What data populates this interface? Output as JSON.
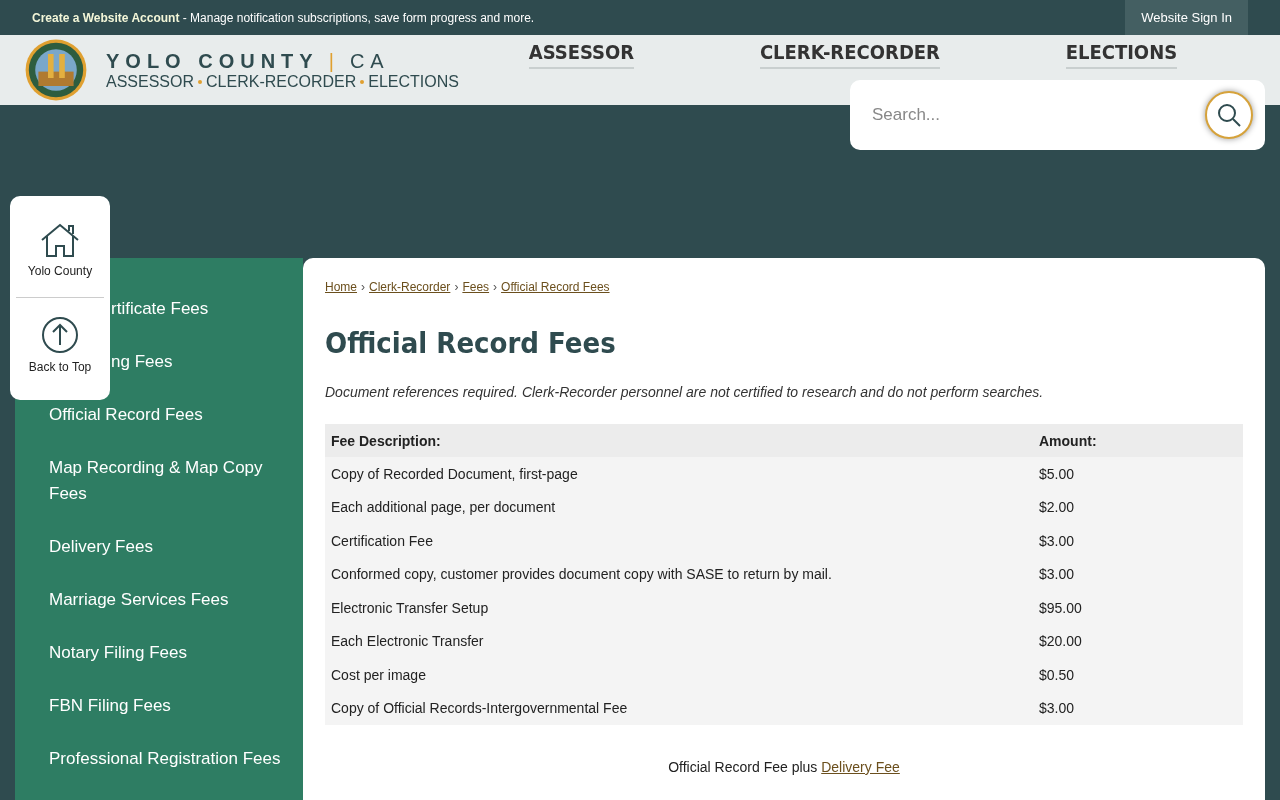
{
  "top_bar": {
    "link": "Create a Website Account",
    "text": " - Manage notification subscriptions, save form progress and more.",
    "sign_in": "Website Sign In"
  },
  "header": {
    "title": "YOLO COUNTY",
    "title_divider": "|",
    "title_suffix": "CA",
    "subtitle": [
      "ASSESSOR",
      "CLERK-RECORDER",
      "ELECTIONS"
    ],
    "nav": [
      {
        "label": "ASSESSOR"
      },
      {
        "label": "CLERK-RECORDER"
      },
      {
        "label": "ELECTIONS"
      }
    ]
  },
  "search": {
    "placeholder": "Search..."
  },
  "float_widget": [
    {
      "kind": "home",
      "label": "Yolo County"
    },
    {
      "kind": "top",
      "label": "Back to Top"
    }
  ],
  "sidebar": {
    "items": [
      {
        "label": "rtificate Fees",
        "kind": "partial"
      },
      {
        "label": "ng Fees",
        "kind": "partial"
      },
      {
        "label": "Official Record Fees",
        "kind": "full"
      },
      {
        "label": "Map Recording & Map Copy Fees",
        "kind": "full"
      },
      {
        "label": "Delivery Fees",
        "kind": "full"
      },
      {
        "label": "Marriage Services Fees",
        "kind": "full"
      },
      {
        "label": "Notary Filing Fees",
        "kind": "full"
      },
      {
        "label": "FBN Filing Fees",
        "kind": "full"
      },
      {
        "label": "Professional Registration Fees",
        "kind": "full"
      }
    ]
  },
  "breadcrumb": {
    "separator": "›",
    "items": [
      "Home",
      "Clerk-Recorder",
      "Fees",
      "Official Record Fees"
    ]
  },
  "page_title": "Official Record Fees",
  "intro": "Document references required. Clerk-Recorder personnel are not certified to research and do not perform searches.",
  "table": {
    "columns": [
      "Fee Description:",
      "Amount:"
    ],
    "rows": [
      [
        "Copy of Recorded Document, first-page",
        "$5.00"
      ],
      [
        "Each additional page, per document",
        "$2.00"
      ],
      [
        "Certification Fee",
        "$3.00"
      ],
      [
        "Conformed copy, customer provides document copy with SASE to return by mail.",
        "$3.00"
      ],
      [
        "Electronic Transfer Setup",
        "$95.00"
      ],
      [
        "Each Electronic Transfer",
        "$20.00"
      ],
      [
        "Cost per image",
        "$0.50"
      ],
      [
        "Copy of Official Records-Intergovernmental Fee",
        "$3.00"
      ]
    ]
  },
  "footer_note": {
    "text": "Official Record Fee plus ",
    "link": "Delivery Fee"
  }
}
